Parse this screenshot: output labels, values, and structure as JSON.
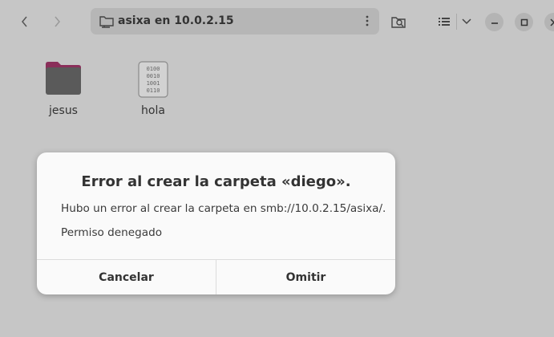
{
  "header": {
    "location_title": "asixa en 10.0.2.15",
    "icons": [
      "chevron-left-icon",
      "chevron-right-icon",
      "network-folder-icon",
      "kebab-menu-icon",
      "search-folder-icon",
      "list-view-icon",
      "chevron-down-icon",
      "minimize-icon",
      "maximize-icon",
      "close-icon"
    ]
  },
  "files": [
    {
      "name": "jesus",
      "icon": "folder-icon"
    },
    {
      "name": "hola",
      "icon": "binary-file-icon"
    }
  ],
  "dialog": {
    "title": "Error al crear la carpeta «diego».",
    "message": "Hubo un error al crear la carpeta en smb://10.0.2.15/asixa/.",
    "detail": "Permiso denegado",
    "cancel_label": "Cancelar",
    "skip_label": "Omitir"
  },
  "colors": {
    "background": "#c6c6c6",
    "dialog": "#fafafa",
    "folder": "#5a5a5a",
    "folder_tab": "#8a2f5a"
  }
}
